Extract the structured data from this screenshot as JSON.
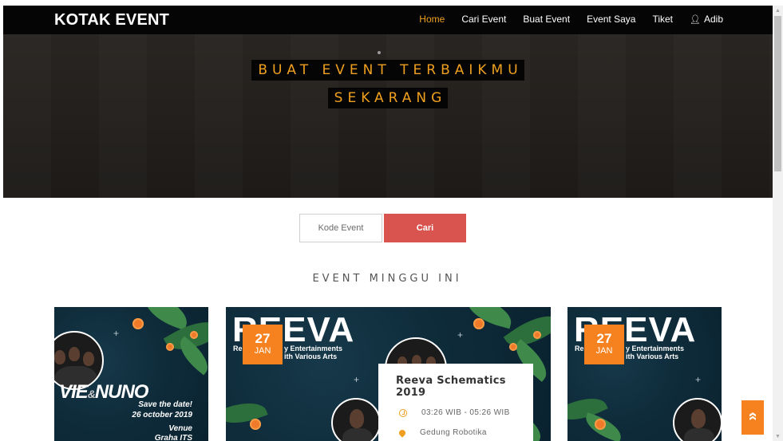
{
  "navbar": {
    "brand": "KOTAK EVENT",
    "items": [
      {
        "label": "Home",
        "active": true
      },
      {
        "label": "Cari Event",
        "active": false
      },
      {
        "label": "Buat Event",
        "active": false
      },
      {
        "label": "Event Saya",
        "active": false
      },
      {
        "label": "Tiket",
        "active": false
      },
      {
        "label": "Adib",
        "icon": "user-icon",
        "active": false
      }
    ]
  },
  "hero": {
    "line1": "BUAT EVENT TERBAIKMU",
    "line2": "SEKARANG"
  },
  "search": {
    "placeholder": "Kode Event",
    "button_label": "Cari"
  },
  "section": {
    "title": "EVENT MINGGU INI"
  },
  "events": [
    {
      "poster": {
        "logo": "VIE",
        "logo_amp": "&",
        "logo2": "NUNO",
        "save_the_date": "Save the date!",
        "date": "26 october 2019",
        "venue_label": "Venue",
        "venue": "Graha ITS"
      }
    },
    {
      "date_day": "27",
      "date_month": "JAN",
      "poster_logo": "REEVA",
      "poster_sub1": "Re",
      "poster_sub2": "y Entertainments",
      "poster_sub3": "ith Various Arts",
      "title": "Reeva Schematics 2019",
      "time": "03:26 WIB - 05:26 WIB",
      "location": "Gedung Robotika"
    },
    {
      "date_day": "27",
      "date_month": "JAN",
      "poster_logo": "REEVA",
      "poster_sub1": "Re",
      "poster_sub2": "y Entertainments",
      "poster_sub3": "ith Various Arts"
    }
  ],
  "colors": {
    "accent": "#f0a020",
    "badge": "#f5821f",
    "search_button": "#d9534f",
    "navbar": "#050505"
  },
  "scroll_top_icon": "double-chevron-up-icon"
}
